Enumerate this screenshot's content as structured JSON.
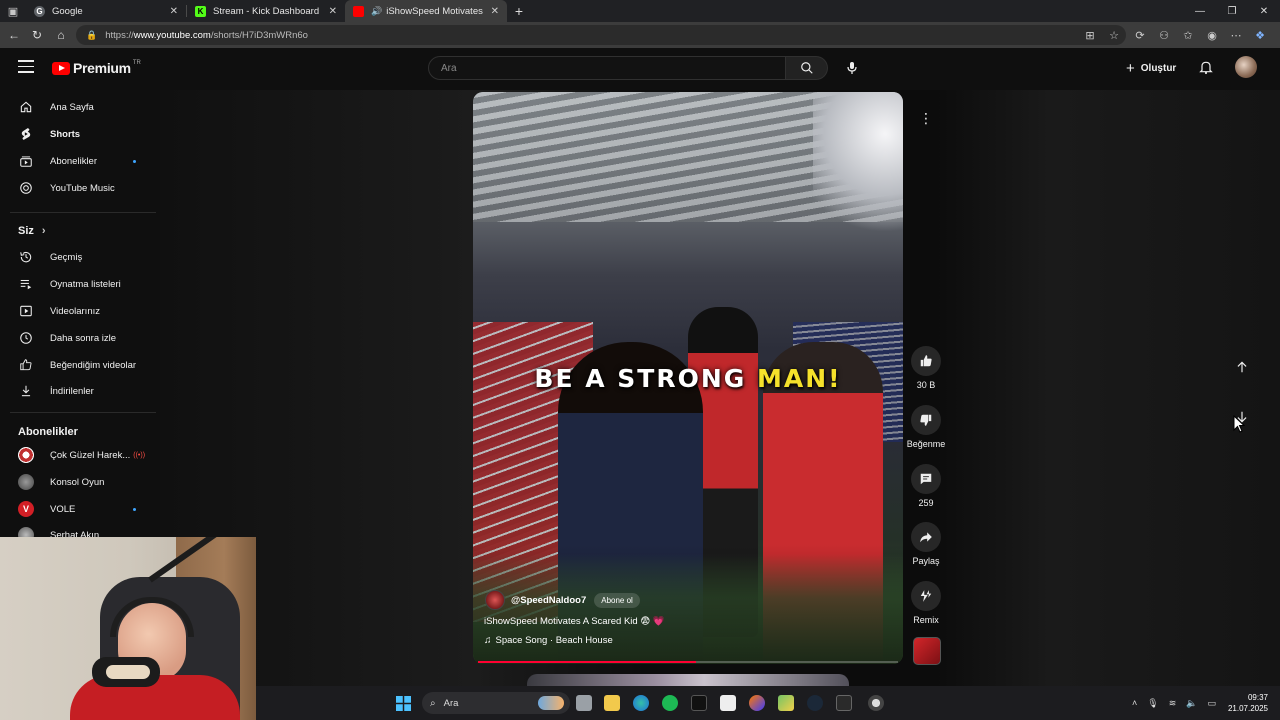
{
  "browser": {
    "tabs": [
      {
        "title": "Google",
        "favicon": "google-icon"
      },
      {
        "title": "Stream - Kick Dashboard",
        "favicon": "kick-icon"
      },
      {
        "title": "iShowSpeed Motivates A Sca",
        "favicon": "youtube-icon"
      }
    ],
    "url_prefix": "https://",
    "url_domain": "www.youtube.com",
    "url_path": "/shorts/H7iD3mWRn6o"
  },
  "header": {
    "logo_text": "Premium",
    "logo_region": "TR",
    "search_placeholder": "Ara",
    "create_label": "Oluştur"
  },
  "sidebar": {
    "main_items": [
      {
        "label": "Ana Sayfa",
        "icon": "home-icon"
      },
      {
        "label": "Shorts",
        "icon": "shorts-icon"
      },
      {
        "label": "Abonelikler",
        "icon": "subscriptions-icon"
      },
      {
        "label": "YouTube Music",
        "icon": "youtube-music-icon"
      }
    ],
    "you_heading": "Siz",
    "you_items": [
      {
        "label": "Geçmiş",
        "icon": "history-icon"
      },
      {
        "label": "Oynatma listeleri",
        "icon": "playlists-icon"
      },
      {
        "label": "Videolarınız",
        "icon": "your-videos-icon"
      },
      {
        "label": "Daha sonra izle",
        "icon": "watch-later-icon"
      },
      {
        "label": "Beğendiğim videolar",
        "icon": "liked-videos-icon"
      },
      {
        "label": "İndirilenler",
        "icon": "downloads-icon"
      }
    ],
    "subs_heading": "Abonelikler",
    "subs": [
      {
        "label": "Çok Güzel Harek...",
        "live": "((•))"
      },
      {
        "label": "Konsol Oyun"
      },
      {
        "label": "VOLE"
      },
      {
        "label": "Serhat Akın"
      }
    ]
  },
  "video": {
    "caption_white": "BE A STRONG ",
    "caption_yellow": "MAN!",
    "channel": "@SpeedNaldoo7",
    "subscribe_label": "Abone ol",
    "title": "iShowSpeed Motivates A Scared Kid 😨 ",
    "title_heart": "💗",
    "song": "Space Song · Beach House",
    "progress": 0.52
  },
  "actions": {
    "likes": "30 B",
    "dislike_label": "Beğenme",
    "comments": "259",
    "share_label": "Paylaş",
    "remix_label": "Remix"
  },
  "taskbar": {
    "search_label": "Ara",
    "time": "09:37",
    "date": "21.07.2025"
  },
  "colors": {
    "youtube_red": "#ff0000",
    "caption_highlight": "#f5e12b",
    "progress_red": "#ff0033"
  }
}
